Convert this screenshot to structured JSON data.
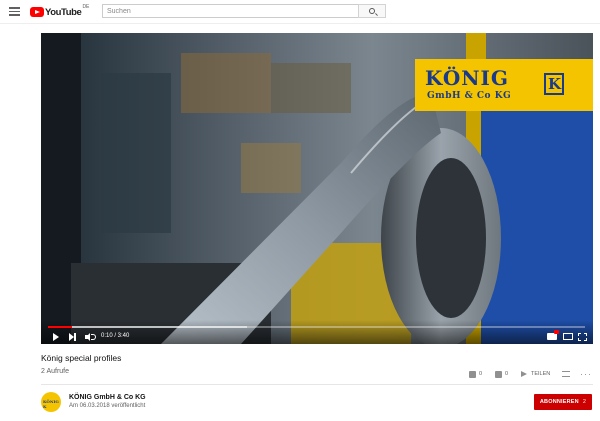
{
  "masthead": {
    "logo_text": "YouTube",
    "logo_region": "DE",
    "search_placeholder": "Suchen",
    "icons": [
      "hamburger-icon",
      "youtube-logo-icon",
      "search-icon"
    ]
  },
  "player": {
    "overlay": {
      "brand_name": "KÖNIG",
      "brand_sub": "GmbH & Co KG",
      "emblem_letter": "K"
    },
    "time": "0:10 / 3:40",
    "progress_played_fraction": 0.045,
    "progress_loaded_fraction": 0.37,
    "icons": [
      "play-icon",
      "next-icon",
      "volume-icon",
      "captions-icon",
      "theater-icon",
      "fullscreen-icon"
    ],
    "colors": {
      "progress": "#ff0000",
      "brand_yellow": "#f5c400",
      "brand_blue": "#1a3a8a"
    }
  },
  "video": {
    "title": "König special profiles",
    "views": "2 Aufrufe",
    "likes": "0",
    "dislikes": "0",
    "share_label": "TEILEN"
  },
  "channel": {
    "name": "KÖNIG GmbH & Co KG",
    "published": "Am 06.03.2018 veröffentlicht",
    "avatar_text": "KÖNIG K",
    "subscribe_label": "ABONNIEREN",
    "subscriber_count": "2",
    "colors": {
      "subscribe": "#cc0000"
    }
  }
}
